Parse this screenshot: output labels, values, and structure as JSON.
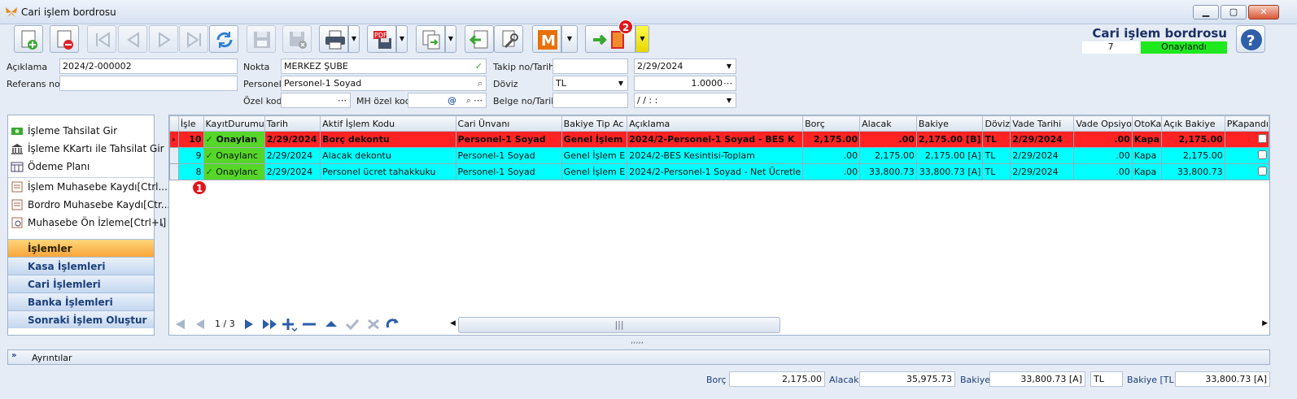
{
  "window": {
    "title": "Cari işlem bordrosu"
  },
  "header": {
    "title": "Cari işlem bordrosu",
    "record_no": "7",
    "status": "Onaylandı"
  },
  "form": {
    "aciklama_label": "Açıklama",
    "aciklama_value": "2024/2-000002",
    "referans_label": "Referans no",
    "referans_value": "",
    "nokta_label": "Nokta",
    "nokta_value": "MERKEZ ŞUBE",
    "personel_label": "Personel",
    "personel_value": "Personel-1 Soyad",
    "ozel_kod_label": "Özel kod",
    "ozel_kod_value": "",
    "mh_ozel_kod_label": "MH özel kod",
    "mh_ozel_kod_value": "",
    "takip_label": "Takip no/Tarih",
    "takip_value": "",
    "takip_date": "2/29/2024",
    "doviz_label": "Döviz",
    "doviz_value": "TL",
    "doviz_rate": "1.0000",
    "belge_label": "Belge no/Tarih",
    "belge_value": "",
    "belge_date": "/ /     : :"
  },
  "sidebar": {
    "items": [
      {
        "label": "İşleme Tahsilat Gir"
      },
      {
        "label": "İşleme KKartı ile Tahsilat Gir"
      },
      {
        "label": "Ödeme Planı"
      },
      {
        "label": "İşlem Muhasebe Kaydı[Ctrl..."
      },
      {
        "label": "Bordro Muhasebe Kaydı[Ctr..."
      },
      {
        "label": "Muhasebe Ön İzleme[Ctrl+I]"
      }
    ],
    "groups": [
      {
        "label": "İşlemler"
      },
      {
        "label": "Kasa İşlemleri"
      },
      {
        "label": "Cari İşlemleri"
      },
      {
        "label": "Banka İşlemleri"
      },
      {
        "label": "Sonraki İşlem Oluştur"
      }
    ]
  },
  "grid": {
    "columns": [
      "İşle",
      "KayıtDurumu",
      "Tarih",
      "Aktif İşlem Kodu",
      "Cari Ünvanı",
      "Bakiye Tip Ac",
      "Açıklama",
      "Borç",
      "Alacak",
      "Bakiye",
      "Döviz",
      "Vade Tarihi",
      "Vade Opsiyo",
      "OtoKa",
      "Açık Bakiye",
      "PKapandı"
    ],
    "rows": [
      {
        "isle": "10",
        "durum": "Onaylan",
        "tarih": "2/29/2024",
        "kod": "Borç dekontu",
        "cari": "Personel-1 Soyad",
        "tip": "Genel İşlem",
        "aciklama": "2024/2-Personel-1 Soyad - BES K",
        "borc": "2,175.00",
        "alacak": ".00",
        "bakiye": "2,175.00 [B]",
        "doviz": "TL",
        "vade": "2/29/2024",
        "opsiyon": ".00",
        "oto": "Kapa",
        "acik": "2,175.00"
      },
      {
        "isle": "9",
        "durum": "Onaylanc",
        "tarih": "2/29/2024",
        "kod": "Alacak dekontu",
        "cari": "Personel-1 Soyad",
        "tip": "Genel İşlem E",
        "aciklama": "2024/2-BES Kesintisi-Toplam",
        "borc": ".00",
        "alacak": "2,175.00",
        "bakiye": "2,175.00 [A]",
        "doviz": "TL",
        "vade": "2/29/2024",
        "opsiyon": ".00",
        "oto": "Kapa",
        "acik": "2,175.00"
      },
      {
        "isle": "8",
        "durum": "Onaylanc",
        "tarih": "2/29/2024",
        "kod": "Personel ücret tahakkuku",
        "cari": "Personel-1 Soyad",
        "tip": "Genel İşlem E",
        "aciklama": "2024/2-Personel-1 Soyad - Net Ücretle",
        "borc": ".00",
        "alacak": "33,800.73",
        "bakiye": "33,800.73 [A]",
        "doviz": "TL",
        "vade": "2/29/2024",
        "opsiyon": ".00",
        "oto": "Kapa",
        "acik": "33,800.73"
      }
    ],
    "pager": "1 / 3"
  },
  "annotations": {
    "one": "1",
    "two": "2"
  },
  "details": {
    "label": "Ayrıntılar"
  },
  "footer": {
    "borc_label": "Borç",
    "borc_value": "2,175.00",
    "alacak_label": "Alacak",
    "alacak_value": "35,975.73",
    "bakiye_label": "Bakiye",
    "bakiye_value": "33,800.73 [A]",
    "doviz_value": "TL",
    "bakiye_tl_label": "Bakiye [TL]",
    "bakiye_tl_value": "33,800.73 [A]"
  },
  "colors": {
    "red_row": "#ff2323",
    "cyan_row": "#00ffff",
    "status_green": "#55d628",
    "accent": "#1b3f7a"
  }
}
